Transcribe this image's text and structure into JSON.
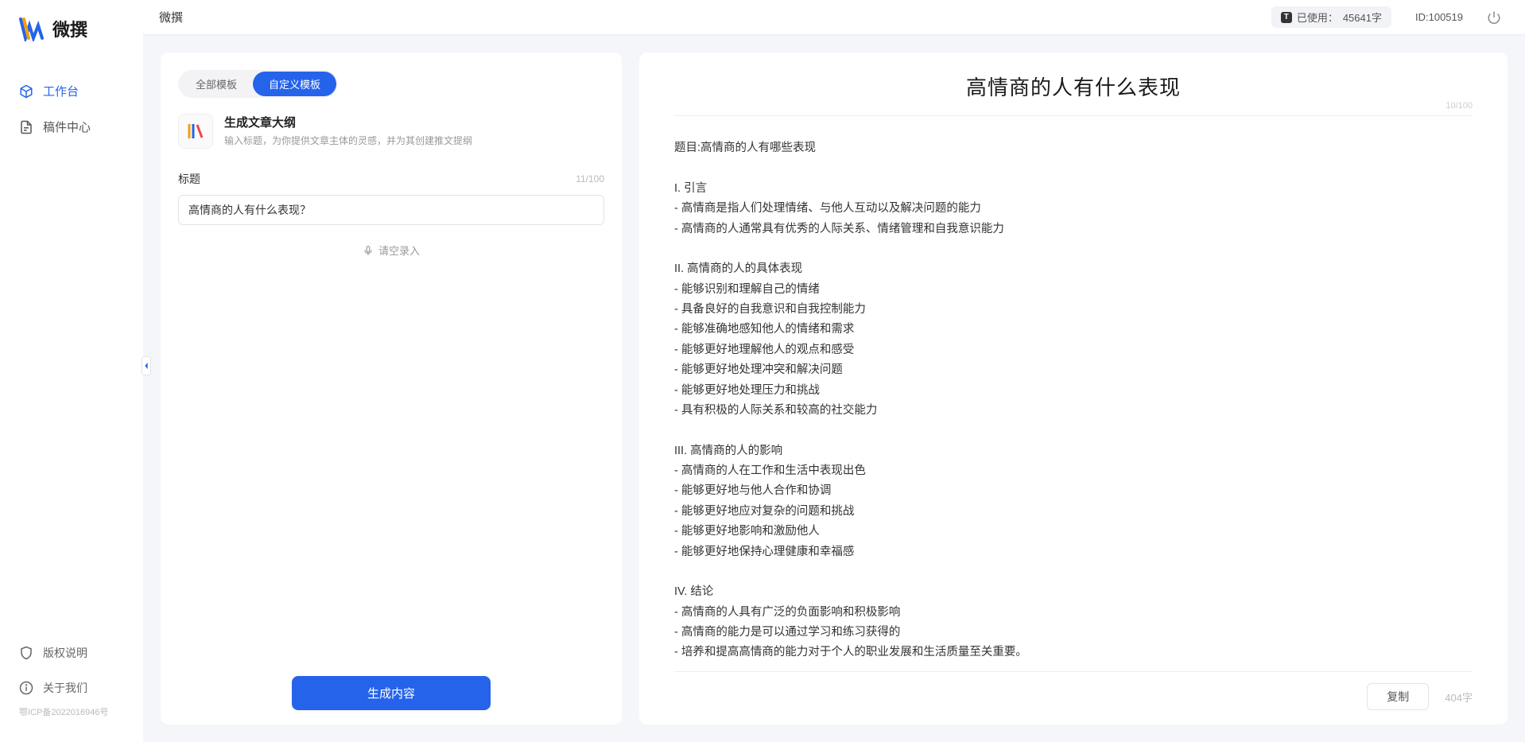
{
  "brand": {
    "name": "微撰"
  },
  "nav": {
    "workspace": "工作台",
    "drafts": "稿件中心",
    "copyright": "版权说明",
    "about": "关于我们",
    "icp": "鄂ICP备2022016946号"
  },
  "topbar": {
    "title": "微撰",
    "usage_label": "已使用：",
    "usage_value": "45641字",
    "user_id_label": "ID:",
    "user_id": "100519"
  },
  "leftPanel": {
    "tab_all": "全部模板",
    "tab_custom": "自定义模板",
    "template": {
      "title": "生成文章大纲",
      "desc": "输入标题，为你提供文章主体的灵感，并为其创建推文提纲"
    },
    "field_label": "标题",
    "char_counter": "11/100",
    "input_value": "高情商的人有什么表现？",
    "voice_label": "请空录入",
    "generate_btn": "生成内容"
  },
  "output": {
    "title": "高情商的人有什么表现",
    "title_counter": "10/100",
    "body": "题目:高情商的人有哪些表现\n\nI. 引言\n- 高情商是指人们处理情绪、与他人互动以及解决问题的能力\n- 高情商的人通常具有优秀的人际关系、情绪管理和自我意识能力\n\nII. 高情商的人的具体表现\n- 能够识别和理解自己的情绪\n- 具备良好的自我意识和自我控制能力\n- 能够准确地感知他人的情绪和需求\n- 能够更好地理解他人的观点和感受\n- 能够更好地处理冲突和解决问题\n- 能够更好地处理压力和挑战\n- 具有积极的人际关系和较高的社交能力\n\nIII. 高情商的人的影响\n- 高情商的人在工作和生活中表现出色\n- 能够更好地与他人合作和协调\n- 能够更好地应对复杂的问题和挑战\n- 能够更好地影响和激励他人\n- 能够更好地保持心理健康和幸福感\n\nIV. 结论\n- 高情商的人具有广泛的负面影响和积极影响\n- 高情商的能力是可以通过学习和练习获得的\n- 培养和提高高情商的能力对于个人的职业发展和生活质量至关重要。",
    "copy_btn": "复制",
    "word_count": "404字"
  }
}
